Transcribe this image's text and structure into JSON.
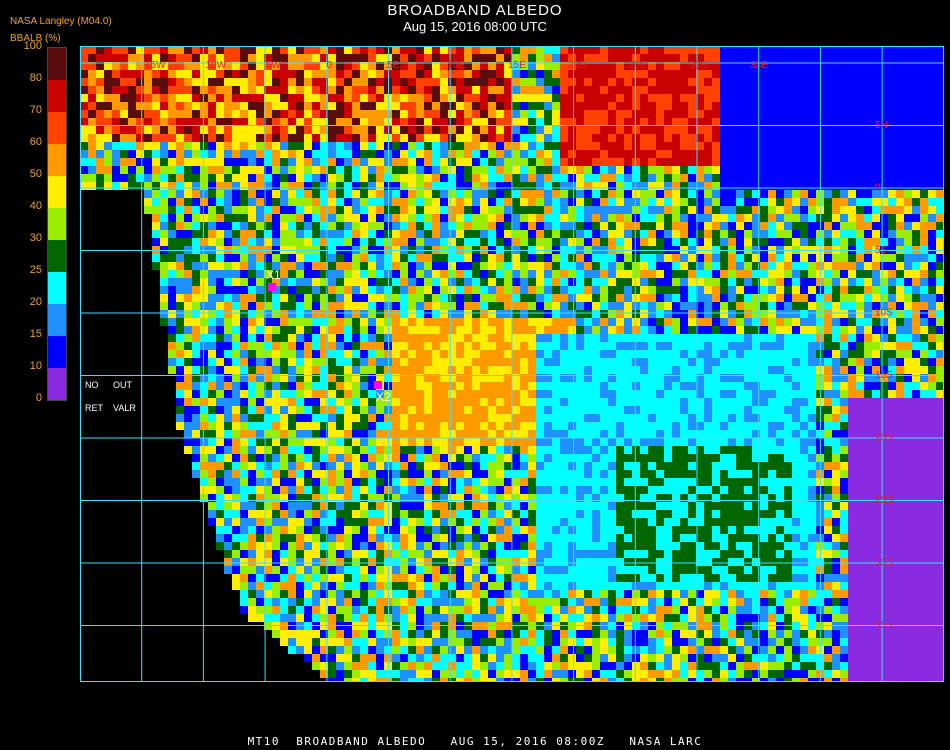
{
  "header": {
    "title": "BROADBAND ALBEDO",
    "subtitle": "Aug 15, 2016 08:00 UTC",
    "source": "NASA Langley (M04.0)",
    "unit_label": "BBALB (%)"
  },
  "legend": {
    "ticks": [
      "100",
      "80",
      "70",
      "60",
      "50",
      "40",
      "30",
      "25",
      "20",
      "15",
      "10",
      "0"
    ],
    "colors": [
      "#5a0d0d",
      "#c80000",
      "#ff4000",
      "#ff9900",
      "#ffee00",
      "#99ee00",
      "#006600",
      "#00ffff",
      "#1e90ff",
      "#0000ff",
      "#8a2be2"
    ],
    "no_ret_label": "NO RET",
    "out_valr_label": "OUT VALR",
    "no_ret_parts": [
      "NO",
      "RET"
    ],
    "out_valr_parts": [
      "OUT",
      "VALR"
    ]
  },
  "map": {
    "lon_labels": [
      "15W",
      "10W",
      "5W",
      "0",
      "5E",
      "10E",
      "15E",
      "20E",
      "25E",
      "30E",
      "35E"
    ],
    "lat_labels": [
      "5N",
      "0",
      "5S",
      "10S",
      "15S",
      "20S",
      "25S",
      "30S",
      "35S"
    ],
    "markers": [
      {
        "label": "X1",
        "color": "#ff00ff"
      },
      {
        "label": "X2",
        "color": "#ff00ff"
      }
    ]
  },
  "footer": {
    "caption": "MT10  BROADBAND ALBEDO   AUG 15, 2016 08:00Z   NASA LARC"
  }
}
